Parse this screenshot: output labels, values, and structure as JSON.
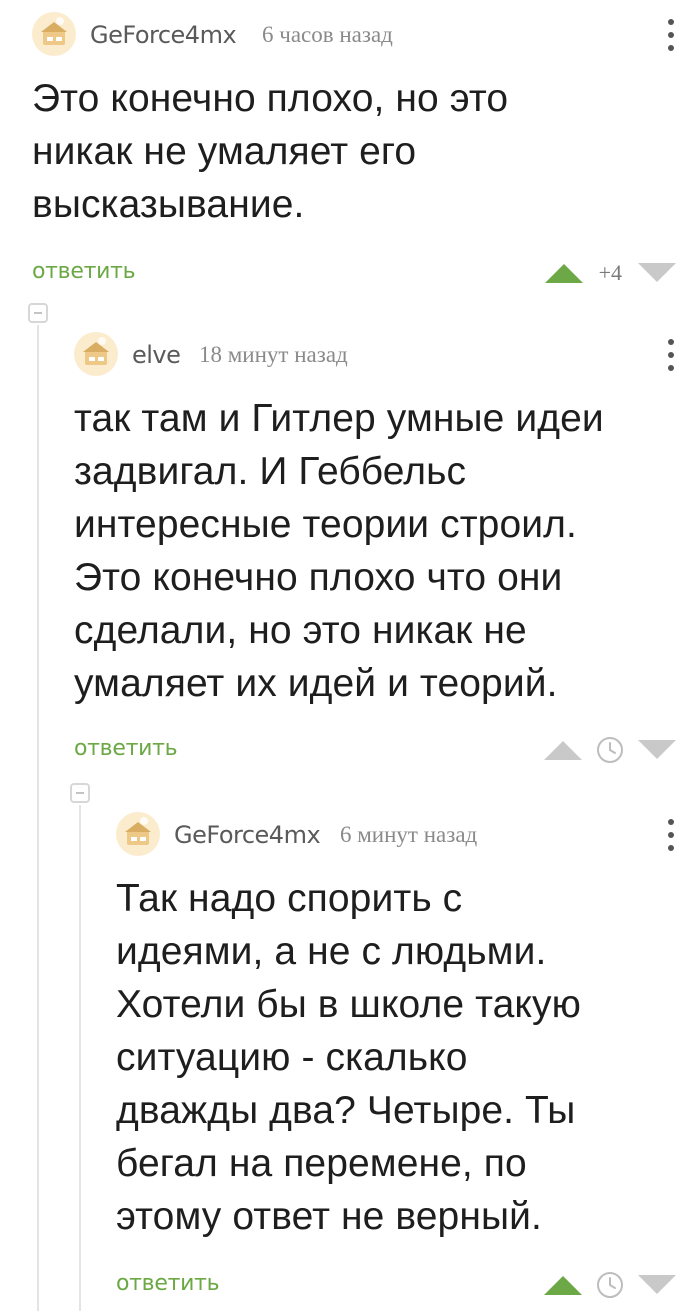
{
  "comments": [
    {
      "author": "GeForce4mx",
      "time": "6 часов назад",
      "lines": [
        "Это конечно плохо, но это",
        "никак не умаляет его",
        "высказывание."
      ],
      "reply_label": "ответить",
      "rating": "+4",
      "upvote_color": "#6ca845"
    },
    {
      "author": "elve",
      "time": "18 минут назад",
      "lines": [
        "так там и Гитлер умные идеи",
        "задвигал. И Геббельс",
        "интересные теории строил.",
        "Это конечно плохо что они",
        "сделали, но это никак не",
        "умаляет их идей и теорий."
      ],
      "reply_label": "ответить",
      "rating_icon": "clock-icon",
      "upvote_color": "#c9c9c9"
    },
    {
      "author": "GeForce4mx",
      "time": "6 минут назад",
      "lines": [
        "Так надо спорить с",
        "идеями, а не с людьми.",
        "Хотели бы в школе такую",
        "ситуацию - скалько",
        "дважды два? Четыре. Ты",
        "бегал на перемене, по",
        "этому ответ не верный."
      ],
      "reply_label": "ответить",
      "rating_icon": "clock-icon",
      "upvote_color": "#6ca845"
    }
  ],
  "colors": {
    "accent": "#6ca845",
    "muted": "#c9c9c9",
    "thread_line": "#e4e4e4"
  }
}
